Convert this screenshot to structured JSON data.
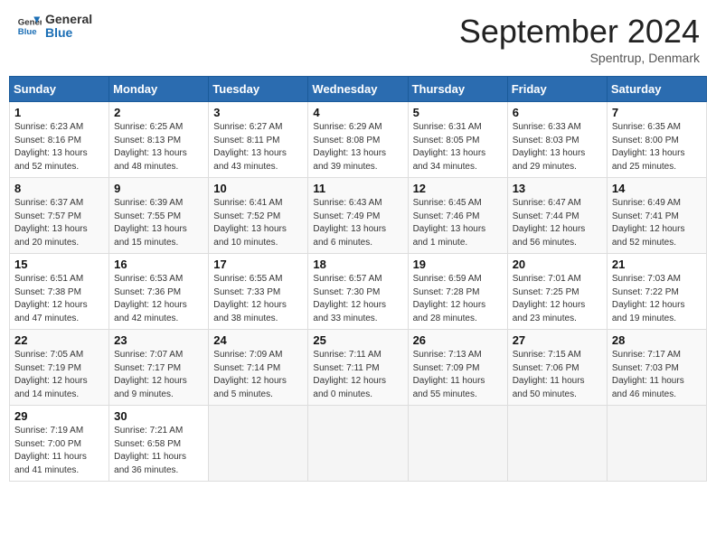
{
  "header": {
    "logo_general": "General",
    "logo_blue": "Blue",
    "month_title": "September 2024",
    "location": "Spentrup, Denmark"
  },
  "weekdays": [
    "Sunday",
    "Monday",
    "Tuesday",
    "Wednesday",
    "Thursday",
    "Friday",
    "Saturday"
  ],
  "weeks": [
    [
      {
        "day": "1",
        "sunrise": "6:23 AM",
        "sunset": "8:16 PM",
        "daylight": "13 hours and 52 minutes."
      },
      {
        "day": "2",
        "sunrise": "6:25 AM",
        "sunset": "8:13 PM",
        "daylight": "13 hours and 48 minutes."
      },
      {
        "day": "3",
        "sunrise": "6:27 AM",
        "sunset": "8:11 PM",
        "daylight": "13 hours and 43 minutes."
      },
      {
        "day": "4",
        "sunrise": "6:29 AM",
        "sunset": "8:08 PM",
        "daylight": "13 hours and 39 minutes."
      },
      {
        "day": "5",
        "sunrise": "6:31 AM",
        "sunset": "8:05 PM",
        "daylight": "13 hours and 34 minutes."
      },
      {
        "day": "6",
        "sunrise": "6:33 AM",
        "sunset": "8:03 PM",
        "daylight": "13 hours and 29 minutes."
      },
      {
        "day": "7",
        "sunrise": "6:35 AM",
        "sunset": "8:00 PM",
        "daylight": "13 hours and 25 minutes."
      }
    ],
    [
      {
        "day": "8",
        "sunrise": "6:37 AM",
        "sunset": "7:57 PM",
        "daylight": "13 hours and 20 minutes."
      },
      {
        "day": "9",
        "sunrise": "6:39 AM",
        "sunset": "7:55 PM",
        "daylight": "13 hours and 15 minutes."
      },
      {
        "day": "10",
        "sunrise": "6:41 AM",
        "sunset": "7:52 PM",
        "daylight": "13 hours and 10 minutes."
      },
      {
        "day": "11",
        "sunrise": "6:43 AM",
        "sunset": "7:49 PM",
        "daylight": "13 hours and 6 minutes."
      },
      {
        "day": "12",
        "sunrise": "6:45 AM",
        "sunset": "7:46 PM",
        "daylight": "13 hours and 1 minute."
      },
      {
        "day": "13",
        "sunrise": "6:47 AM",
        "sunset": "7:44 PM",
        "daylight": "12 hours and 56 minutes."
      },
      {
        "day": "14",
        "sunrise": "6:49 AM",
        "sunset": "7:41 PM",
        "daylight": "12 hours and 52 minutes."
      }
    ],
    [
      {
        "day": "15",
        "sunrise": "6:51 AM",
        "sunset": "7:38 PM",
        "daylight": "12 hours and 47 minutes."
      },
      {
        "day": "16",
        "sunrise": "6:53 AM",
        "sunset": "7:36 PM",
        "daylight": "12 hours and 42 minutes."
      },
      {
        "day": "17",
        "sunrise": "6:55 AM",
        "sunset": "7:33 PM",
        "daylight": "12 hours and 38 minutes."
      },
      {
        "day": "18",
        "sunrise": "6:57 AM",
        "sunset": "7:30 PM",
        "daylight": "12 hours and 33 minutes."
      },
      {
        "day": "19",
        "sunrise": "6:59 AM",
        "sunset": "7:28 PM",
        "daylight": "12 hours and 28 minutes."
      },
      {
        "day": "20",
        "sunrise": "7:01 AM",
        "sunset": "7:25 PM",
        "daylight": "12 hours and 23 minutes."
      },
      {
        "day": "21",
        "sunrise": "7:03 AM",
        "sunset": "7:22 PM",
        "daylight": "12 hours and 19 minutes."
      }
    ],
    [
      {
        "day": "22",
        "sunrise": "7:05 AM",
        "sunset": "7:19 PM",
        "daylight": "12 hours and 14 minutes."
      },
      {
        "day": "23",
        "sunrise": "7:07 AM",
        "sunset": "7:17 PM",
        "daylight": "12 hours and 9 minutes."
      },
      {
        "day": "24",
        "sunrise": "7:09 AM",
        "sunset": "7:14 PM",
        "daylight": "12 hours and 5 minutes."
      },
      {
        "day": "25",
        "sunrise": "7:11 AM",
        "sunset": "7:11 PM",
        "daylight": "12 hours and 0 minutes."
      },
      {
        "day": "26",
        "sunrise": "7:13 AM",
        "sunset": "7:09 PM",
        "daylight": "11 hours and 55 minutes."
      },
      {
        "day": "27",
        "sunrise": "7:15 AM",
        "sunset": "7:06 PM",
        "daylight": "11 hours and 50 minutes."
      },
      {
        "day": "28",
        "sunrise": "7:17 AM",
        "sunset": "7:03 PM",
        "daylight": "11 hours and 46 minutes."
      }
    ],
    [
      {
        "day": "29",
        "sunrise": "7:19 AM",
        "sunset": "7:00 PM",
        "daylight": "11 hours and 41 minutes."
      },
      {
        "day": "30",
        "sunrise": "7:21 AM",
        "sunset": "6:58 PM",
        "daylight": "11 hours and 36 minutes."
      },
      null,
      null,
      null,
      null,
      null
    ]
  ]
}
